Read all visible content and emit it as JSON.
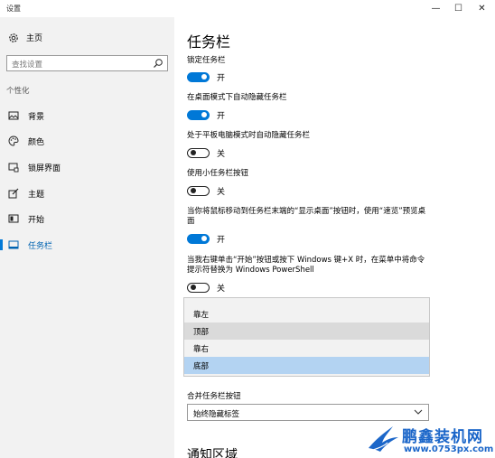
{
  "window": {
    "title": "设置",
    "minimize_glyph": "—",
    "maximize_glyph": "☐",
    "close_glyph": "✕"
  },
  "sidebar": {
    "home_label": "主页",
    "search_placeholder": "查找设置",
    "section_label": "个性化",
    "items": [
      {
        "label": "背景",
        "icon": "picture-icon"
      },
      {
        "label": "颜色",
        "icon": "palette-icon"
      },
      {
        "label": "锁屏界面",
        "icon": "lock-screen-icon"
      },
      {
        "label": "主题",
        "icon": "brush-icon"
      },
      {
        "label": "开始",
        "icon": "start-icon"
      },
      {
        "label": "任务栏",
        "icon": "taskbar-icon",
        "active": true
      }
    ]
  },
  "main": {
    "title": "任务栏",
    "settings": [
      {
        "label": "锁定任务栏",
        "state": "开",
        "on": true
      },
      {
        "label": "在桌面模式下自动隐藏任务栏",
        "state": "开",
        "on": true
      },
      {
        "label": "处于平板电脑模式时自动隐藏任务栏",
        "state": "关",
        "on": false
      },
      {
        "label": "使用小任务栏按钮",
        "state": "关",
        "on": false
      },
      {
        "label": "当你将鼠标移动到任务栏末端的“显示桌面”按钮时，使用“速览”预览桌面",
        "state": "开",
        "on": true
      },
      {
        "label": "当我右键单击“开始”按钮或按下 Windows 键+X 时，在菜单中将命令提示符替换为 Windows PowerShell",
        "state": "关",
        "on": false
      }
    ],
    "position_options": [
      "靠左",
      "顶部",
      "靠右",
      "底部"
    ],
    "position_selected": "底部",
    "position_hover": "顶部",
    "combine_label": "合并任务栏按钮",
    "combine_value": "始终隐藏标签",
    "notification_heading": "通知区域"
  },
  "watermark": {
    "name": "鹏鑫装机网",
    "url": "www.0753px.com"
  },
  "colors": {
    "accent": "#0078d7",
    "sidebar_bg": "#f2f2f2",
    "selected_option_bg": "#b3d3f2",
    "watermark_blue": "#1b66c9"
  }
}
